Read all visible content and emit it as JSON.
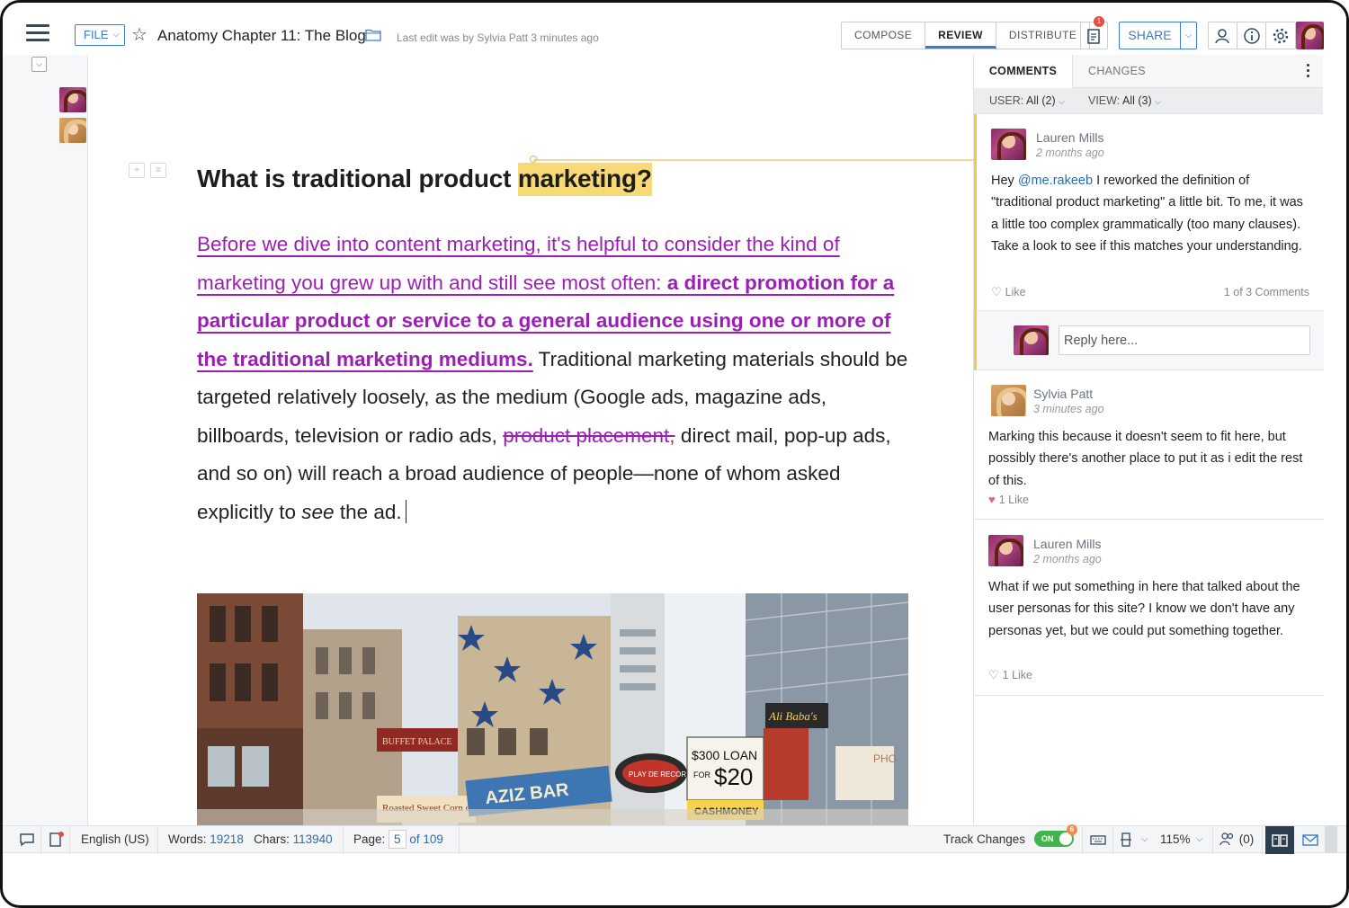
{
  "topbar": {
    "file_label": "FILE",
    "doc_title": "Anatomy Chapter 11: The Blog",
    "last_edit": "Last edit was by Sylvia Patt 3 minutes ago",
    "modes": [
      "COMPOSE",
      "REVIEW",
      "DISTRIBUTE"
    ],
    "active_mode": "REVIEW",
    "notification_count": "1",
    "share_label": "SHARE"
  },
  "document": {
    "heading_plain": "What is traditional product ",
    "heading_highlight": "marketing?",
    "ins_1": "Before we dive into content marketing, it's helpful to consider the kind of marketing you grew up with and still see most often: ",
    "ins_2_bold": "a direct promotion for a particular product or service to a general audience using one or more of the traditional marketing mediums.",
    "text_1": " Traditional marketing materials should be targeted relatively loosely, as the medium (Google ads, magazine ads, billboards, television or radio ads, ",
    "deleted": "product placement,",
    "text_2": " direct mail, pop-up ads, and so on) will reach a broad audience of people—none of whom asked explicitly to ",
    "text_italic": "see",
    "text_3": " the ad."
  },
  "panel": {
    "tabs": [
      "COMMENTS",
      "CHANGES"
    ],
    "active_tab": "COMMENTS",
    "filter_user_label": "USER:",
    "filter_user_value": "All (2)",
    "filter_view_label": "VIEW:",
    "filter_view_value": "All (3)",
    "reply_placeholder": "Reply here...",
    "comments": [
      {
        "author": "Lauren Mills",
        "time": "2 months ago",
        "mention": "@me.rakeeb",
        "text": " I reworked the definition of \"traditional product marketing\" a little bit. To me, it was a little too complex grammatically (too many clauses). Take a look to see if this matches your understanding.",
        "text_prefix": "Hey ",
        "like": "Like",
        "count": "1 of 3 Comments"
      },
      {
        "author": "Sylvia Patt",
        "time": "3 minutes ago",
        "text": "Marking this because it doesn't seem to fit here, but possibly there's another place to put it as i edit the rest of this.",
        "like": "1 Like"
      },
      {
        "author": "Lauren Mills",
        "time": "2 months ago",
        "text": "What if we put something in here that talked about the user personas for this site? I know we don't have any personas yet, but we could put something together.",
        "like": "1 Like"
      }
    ]
  },
  "statusbar": {
    "language": "English (US)",
    "words_label": "Words:",
    "words": "19218",
    "chars_label": "Chars:",
    "chars": "113940",
    "page_label": "Page:",
    "page": "5",
    "page_of": "of 109",
    "track_changes_label": "Track Changes",
    "toggle_state": "ON",
    "toggle_badge": "6",
    "zoom": "115%",
    "collaborators": "(0)"
  },
  "photo_signs": {
    "sign_1": "BUFFET PALACE",
    "sign_2": "Roasted Sweet Corn on the Cob",
    "sign_3": "AZIZ BAR",
    "sign_4": "PLAY DE RECORD",
    "sign_5": "$300 LOAN",
    "sign_6": "FOR",
    "sign_7": "$20",
    "sign_8": "CASHMONEY",
    "sign_9": "Ali Baba's",
    "sign_10": "PHO"
  },
  "colors": {
    "accent_blue": "#3d7cc9",
    "insert_purple": "#9b1fb4",
    "highlight_yellow": "#f8d977",
    "comment_active_border": "#f2c94c",
    "toggle_green": "#3fb44f"
  }
}
